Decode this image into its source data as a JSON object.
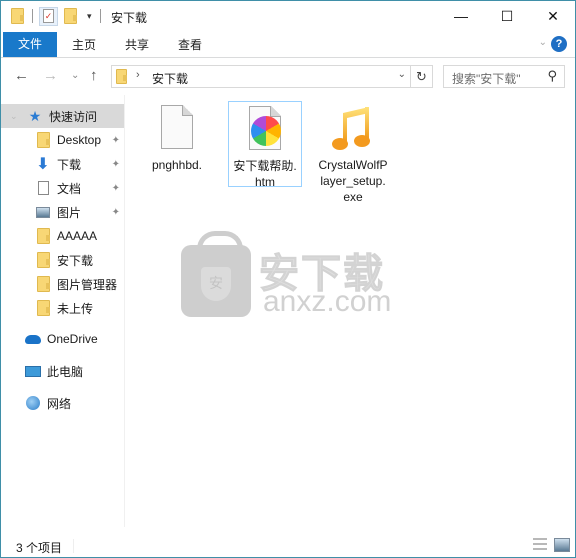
{
  "window": {
    "title": "安下载",
    "controls": {
      "minimize": "—",
      "maximize": "☐",
      "close": "✕"
    }
  },
  "ribbon": {
    "tabs": [
      {
        "label": "文件",
        "active": true
      },
      {
        "label": "主页"
      },
      {
        "label": "共享"
      },
      {
        "label": "查看"
      }
    ],
    "expand_icon": "⌄",
    "help_icon": "?"
  },
  "navbar": {
    "back_icon": "←",
    "forward_icon": "→",
    "recent_icon": "⌄",
    "up_icon": "↑",
    "address": {
      "separator": "›",
      "crumb": "安下载",
      "dropdown_icon": "⌄",
      "refresh_icon": "↻"
    },
    "search": {
      "placeholder": "搜索\"安下载\"",
      "icon": "⚲"
    }
  },
  "sidebar": {
    "quick_access": {
      "label": "快速访问",
      "chevron": "⌄",
      "icon": "★"
    },
    "items": [
      {
        "label": "Desktop",
        "icon": "folder-icon",
        "pinned": true
      },
      {
        "label": "下载",
        "icon": "download-icon",
        "pinned": true
      },
      {
        "label": "文档",
        "icon": "document-icon",
        "pinned": true
      },
      {
        "label": "图片",
        "icon": "pictures-icon",
        "pinned": true
      },
      {
        "label": "AAAAA",
        "icon": "folder-icon",
        "pinned": false
      },
      {
        "label": "安下载",
        "icon": "folder-icon",
        "pinned": false
      },
      {
        "label": "图片管理器",
        "icon": "folder-icon",
        "pinned": false
      },
      {
        "label": "未上传",
        "icon": "folder-icon",
        "pinned": false
      }
    ],
    "pin_icon": "📌",
    "onedrive": {
      "label": "OneDrive"
    },
    "this_pc": {
      "label": "此电脑"
    },
    "network": {
      "label": "网络"
    }
  },
  "files": [
    {
      "name": "pnghhbd.",
      "icon": "blank-file-icon"
    },
    {
      "name": "安下载帮助.htm",
      "icon": "html-file-icon",
      "focused": true
    },
    {
      "name": "CrystalWolfPlayer_setup.exe",
      "icon": "music-note-icon"
    }
  ],
  "watermark": {
    "cn": "安下载",
    "en": "anxz.com",
    "badge": "安"
  },
  "status": {
    "item_count": "3 个项目"
  },
  "colors": {
    "accent": "#1979ca",
    "border": "#3f8fa8",
    "selected_nav": "#d9d9d9",
    "focus_border": "#99d1ff"
  }
}
